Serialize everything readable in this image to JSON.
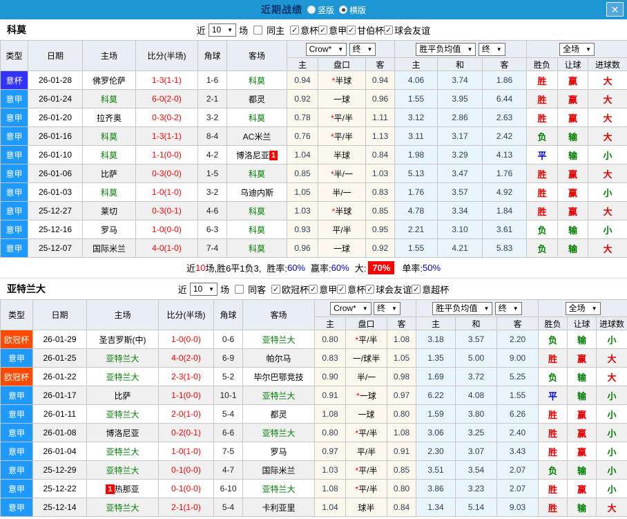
{
  "topbar": {
    "title": "近期战绩",
    "radio_vertical": "竖版",
    "radio_horizontal": "横版",
    "selected": "横版",
    "close": "✕"
  },
  "table_header": {
    "type": "类型",
    "date": "日期",
    "home": "主场",
    "score": "比分(半场)",
    "corner": "角球",
    "away": "客场",
    "crow_dd": "Crow*",
    "final_dd": "终",
    "avg_dd": "胜平负均值",
    "full_dd": "全场",
    "odds_home": "主",
    "handicap": "盘口",
    "odds_away": "客",
    "avg_home": "主",
    "avg_draw": "和",
    "avg_away": "客",
    "result": "胜负",
    "let_result": "让球",
    "goal_result": "进球数"
  },
  "sections": [
    {
      "team": "科莫",
      "filter": {
        "near_label": "近",
        "count": "10",
        "games_label": "场",
        "same_label": "同主",
        "same_checked": false,
        "leagues": [
          {
            "label": "意杯",
            "checked": true
          },
          {
            "label": "意甲",
            "checked": true
          },
          {
            "label": "甘伯杯",
            "checked": true
          },
          {
            "label": "球会友谊",
            "checked": true
          }
        ]
      },
      "rows": [
        {
          "type": "意杯",
          "type_class": "cup",
          "date": "26-01-28",
          "home": "佛罗伦萨",
          "home_green": false,
          "score": "1-3",
          "half": "(1-1)",
          "corners": "1-6",
          "away": "科莫",
          "away_green": true,
          "crow_home": "0.94",
          "handicap": "*半球",
          "crow_away": "0.94",
          "avg_home": "4.06",
          "avg_draw": "3.74",
          "avg_away": "1.86",
          "result": "胜",
          "let_result": "赢",
          "goal_result": "大"
        },
        {
          "type": "意甲",
          "type_class": "league",
          "date": "26-01-24",
          "home": "科莫",
          "home_green": true,
          "score": "6-0",
          "half": "(2-0)",
          "corners": "2-1",
          "away": "都灵",
          "away_green": false,
          "crow_home": "0.92",
          "handicap": "一球",
          "crow_away": "0.96",
          "avg_home": "1.55",
          "avg_draw": "3.95",
          "avg_away": "6.44",
          "result": "胜",
          "let_result": "赢",
          "goal_result": "大"
        },
        {
          "type": "意甲",
          "type_class": "league",
          "date": "26-01-20",
          "home": "拉齐奥",
          "home_green": false,
          "score": "0-3",
          "half": "(0-2)",
          "corners": "3-2",
          "away": "科莫",
          "away_green": true,
          "crow_home": "0.78",
          "handicap": "*平/半",
          "crow_away": "1.11",
          "avg_home": "3.12",
          "avg_draw": "2.86",
          "avg_away": "2.63",
          "result": "胜",
          "let_result": "赢",
          "goal_result": "大"
        },
        {
          "type": "意甲",
          "type_class": "league",
          "date": "26-01-16",
          "home": "科莫",
          "home_green": true,
          "score": "1-3",
          "half": "(1-1)",
          "corners": "8-4",
          "away": "AC米兰",
          "away_green": false,
          "crow_home": "0.76",
          "handicap": "*平/半",
          "crow_away": "1.13",
          "avg_home": "3.11",
          "avg_draw": "3.17",
          "avg_away": "2.42",
          "result": "负",
          "let_result": "输",
          "goal_result": "大"
        },
        {
          "type": "意甲",
          "type_class": "league",
          "date": "26-01-10",
          "home": "科莫",
          "home_green": true,
          "score": "1-1",
          "half": "(0-0)",
          "corners": "4-2",
          "away": "博洛尼亚",
          "away_green": false,
          "away_badge": "1",
          "away_badge_pos": "after",
          "crow_home": "1.04",
          "handicap": "半球",
          "crow_away": "0.84",
          "avg_home": "1.98",
          "avg_draw": "3.29",
          "avg_away": "4.13",
          "result": "平",
          "let_result": "输",
          "goal_result": "小"
        },
        {
          "type": "意甲",
          "type_class": "league",
          "date": "26-01-06",
          "home": "比萨",
          "home_green": false,
          "score": "0-3",
          "half": "(0-0)",
          "corners": "1-5",
          "away": "科莫",
          "away_green": true,
          "crow_home": "0.85",
          "handicap": "*半/一",
          "crow_away": "1.03",
          "avg_home": "5.13",
          "avg_draw": "3.47",
          "avg_away": "1.76",
          "result": "胜",
          "let_result": "赢",
          "goal_result": "大"
        },
        {
          "type": "意甲",
          "type_class": "league",
          "date": "26-01-03",
          "home": "科莫",
          "home_green": true,
          "score": "1-0",
          "half": "(1-0)",
          "corners": "3-2",
          "away": "乌迪内斯",
          "away_green": false,
          "crow_home": "1.05",
          "handicap": "半/一",
          "crow_away": "0.83",
          "avg_home": "1.76",
          "avg_draw": "3.57",
          "avg_away": "4.92",
          "result": "胜",
          "let_result": "赢",
          "goal_result": "小"
        },
        {
          "type": "意甲",
          "type_class": "league",
          "date": "25-12-27",
          "home": "莱切",
          "home_green": false,
          "score": "0-3",
          "half": "(0-1)",
          "corners": "4-6",
          "away": "科莫",
          "away_green": true,
          "crow_home": "1.03",
          "handicap": "*半球",
          "crow_away": "0.85",
          "avg_home": "4.78",
          "avg_draw": "3.34",
          "avg_away": "1.84",
          "result": "胜",
          "let_result": "赢",
          "goal_result": "大"
        },
        {
          "type": "意甲",
          "type_class": "league",
          "date": "25-12-16",
          "home": "罗马",
          "home_green": false,
          "score": "1-0",
          "half": "(0-0)",
          "corners": "6-3",
          "away": "科莫",
          "away_green": true,
          "crow_home": "0.93",
          "handicap": "平/半",
          "crow_away": "0.95",
          "avg_home": "2.21",
          "avg_draw": "3.10",
          "avg_away": "3.61",
          "result": "负",
          "let_result": "输",
          "goal_result": "小"
        },
        {
          "type": "意甲",
          "type_class": "league",
          "date": "25-12-07",
          "home": "国际米兰",
          "home_green": false,
          "score": "4-0",
          "half": "(1-0)",
          "corners": "7-4",
          "away": "科莫",
          "away_green": true,
          "crow_home": "0.96",
          "handicap": "一球",
          "crow_away": "0.92",
          "avg_home": "1.55",
          "avg_draw": "4.21",
          "avg_away": "5.83",
          "result": "负",
          "let_result": "输",
          "goal_result": "大"
        }
      ],
      "summary": {
        "prefix": "近",
        "count": "10",
        "mid": "场,胜6平1负3,",
        "win_label": "胜率:",
        "win": "60%",
        "let_label": "赢率:",
        "let": "60%",
        "big_label": "大:",
        "big": "70%",
        "single_label": "单率:",
        "single": "50%"
      }
    },
    {
      "team": "亚特兰大",
      "filter": {
        "near_label": "近",
        "count": "10",
        "games_label": "场",
        "same_label": "同客",
        "same_checked": false,
        "leagues": [
          {
            "label": "欧冠杯",
            "checked": true
          },
          {
            "label": "意甲",
            "checked": true
          },
          {
            "label": "意杯",
            "checked": true
          },
          {
            "label": "球会友谊",
            "checked": true
          },
          {
            "label": "意超杯",
            "checked": true
          }
        ]
      },
      "rows": [
        {
          "type": "欧冠杯",
          "type_class": "ucl",
          "date": "26-01-29",
          "home": "圣吉罗斯(中)",
          "home_green": false,
          "score": "1-0",
          "half": "(0-0)",
          "corners": "0-6",
          "away": "亚特兰大",
          "away_green": true,
          "crow_home": "0.80",
          "handicap": "*平/半",
          "crow_away": "1.08",
          "avg_home": "3.18",
          "avg_draw": "3.57",
          "avg_away": "2.20",
          "result": "负",
          "let_result": "输",
          "goal_result": "小"
        },
        {
          "type": "意甲",
          "type_class": "league",
          "date": "26-01-25",
          "home": "亚特兰大",
          "home_green": true,
          "score": "4-0",
          "half": "(2-0)",
          "corners": "6-9",
          "away": "帕尔马",
          "away_green": false,
          "crow_home": "0.83",
          "handicap": "一/球半",
          "crow_away": "1.05",
          "avg_home": "1.35",
          "avg_draw": "5.00",
          "avg_away": "9.00",
          "result": "胜",
          "let_result": "赢",
          "goal_result": "大"
        },
        {
          "type": "欧冠杯",
          "type_class": "ucl",
          "date": "26-01-22",
          "home": "亚特兰大",
          "home_green": true,
          "score": "2-3",
          "half": "(1-0)",
          "corners": "5-2",
          "away": "毕尔巴鄂竞技",
          "away_green": false,
          "crow_home": "0.90",
          "handicap": "半/一",
          "crow_away": "0.98",
          "avg_home": "1.69",
          "avg_draw": "3.72",
          "avg_away": "5.25",
          "result": "负",
          "let_result": "输",
          "goal_result": "大"
        },
        {
          "type": "意甲",
          "type_class": "league",
          "date": "26-01-17",
          "home": "比萨",
          "home_green": false,
          "score": "1-1",
          "half": "(0-0)",
          "corners": "10-1",
          "away": "亚特兰大",
          "away_green": true,
          "crow_home": "0.91",
          "handicap": "*一球",
          "crow_away": "0.97",
          "avg_home": "6.22",
          "avg_draw": "4.08",
          "avg_away": "1.55",
          "result": "平",
          "let_result": "输",
          "goal_result": "小"
        },
        {
          "type": "意甲",
          "type_class": "league",
          "date": "26-01-11",
          "home": "亚特兰大",
          "home_green": true,
          "score": "2-0",
          "half": "(1-0)",
          "corners": "5-4",
          "away": "都灵",
          "away_green": false,
          "crow_home": "1.08",
          "handicap": "一球",
          "crow_away": "0.80",
          "avg_home": "1.59",
          "avg_draw": "3.80",
          "avg_away": "6.26",
          "result": "胜",
          "let_result": "赢",
          "goal_result": "小"
        },
        {
          "type": "意甲",
          "type_class": "league",
          "date": "26-01-08",
          "home": "博洛尼亚",
          "home_green": false,
          "score": "0-2",
          "half": "(0-1)",
          "corners": "6-6",
          "away": "亚特兰大",
          "away_green": true,
          "crow_home": "0.80",
          "handicap": "*平/半",
          "crow_away": "1.08",
          "avg_home": "3.06",
          "avg_draw": "3.25",
          "avg_away": "2.40",
          "result": "胜",
          "let_result": "赢",
          "goal_result": "小"
        },
        {
          "type": "意甲",
          "type_class": "league",
          "date": "26-01-04",
          "home": "亚特兰大",
          "home_green": true,
          "score": "1-0",
          "half": "(1-0)",
          "corners": "7-5",
          "away": "罗马",
          "away_green": false,
          "crow_home": "0.97",
          "handicap": "平/半",
          "crow_away": "0.91",
          "avg_home": "2.30",
          "avg_draw": "3.07",
          "avg_away": "3.43",
          "result": "胜",
          "let_result": "赢",
          "goal_result": "小"
        },
        {
          "type": "意甲",
          "type_class": "league",
          "date": "25-12-29",
          "home": "亚特兰大",
          "home_green": true,
          "score": "0-1",
          "half": "(0-0)",
          "corners": "4-7",
          "away": "国际米兰",
          "away_green": false,
          "crow_home": "1.03",
          "handicap": "*平/半",
          "crow_away": "0.85",
          "avg_home": "3.51",
          "avg_draw": "3.54",
          "avg_away": "2.07",
          "result": "负",
          "let_result": "输",
          "goal_result": "小"
        },
        {
          "type": "意甲",
          "type_class": "league",
          "date": "25-12-22",
          "home": "热那亚",
          "home_green": false,
          "home_badge": "1",
          "home_badge_pos": "before",
          "score": "0-1",
          "half": "(0-0)",
          "corners": "6-10",
          "away": "亚特兰大",
          "away_green": true,
          "crow_home": "1.08",
          "handicap": "*平/半",
          "crow_away": "0.80",
          "avg_home": "3.86",
          "avg_draw": "3.23",
          "avg_away": "2.07",
          "result": "胜",
          "let_result": "赢",
          "goal_result": "小"
        },
        {
          "type": "意甲",
          "type_class": "league",
          "date": "25-12-14",
          "home": "亚特兰大",
          "home_green": true,
          "score": "2-1",
          "half": "(1-0)",
          "corners": "5-4",
          "away": "卡利亚里",
          "away_green": false,
          "crow_home": "1.04",
          "handicap": "球半",
          "crow_away": "0.84",
          "avg_home": "1.34",
          "avg_draw": "5.14",
          "avg_away": "9.03",
          "result": "胜",
          "let_result": "输",
          "goal_result": "大"
        }
      ],
      "summary": null
    }
  ]
}
